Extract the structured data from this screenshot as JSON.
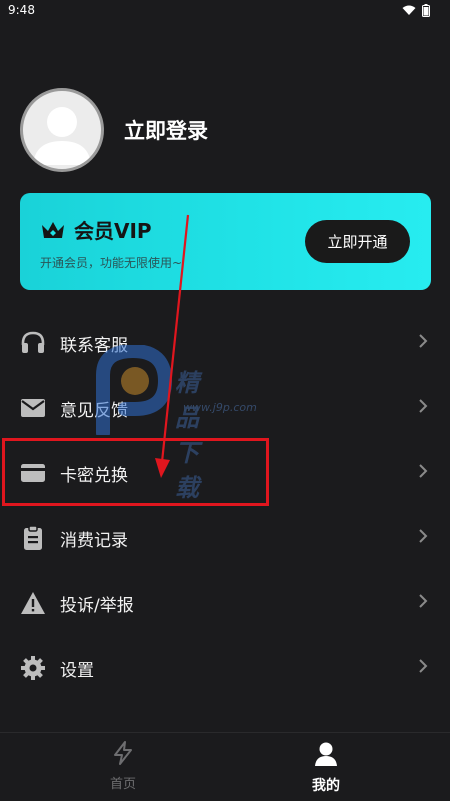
{
  "status": {
    "time": "9:48"
  },
  "profile": {
    "login_label": "立即登录"
  },
  "vip": {
    "title": "会员VIP",
    "subtitle": "开通会员，功能无限使用~",
    "button": "立即开通"
  },
  "menu": {
    "items": [
      {
        "label": "联系客服",
        "icon": "headset-icon"
      },
      {
        "label": "意见反馈",
        "icon": "mail-icon"
      },
      {
        "label": "卡密兑换",
        "icon": "card-icon"
      },
      {
        "label": "消费记录",
        "icon": "clipboard-icon"
      },
      {
        "label": "投诉/举报",
        "icon": "warning-icon"
      },
      {
        "label": "设置",
        "icon": "gear-icon"
      }
    ]
  },
  "watermark": {
    "text": "精品下载",
    "url": "www.j9p.com"
  },
  "tabbar": {
    "tabs": [
      {
        "label": "首页",
        "icon": "bolt-icon",
        "active": false
      },
      {
        "label": "我的",
        "icon": "person-icon",
        "active": true
      }
    ]
  },
  "colors": {
    "background": "#1b1b1d",
    "accent": "#20e2e6",
    "highlight": "#e0161e"
  }
}
